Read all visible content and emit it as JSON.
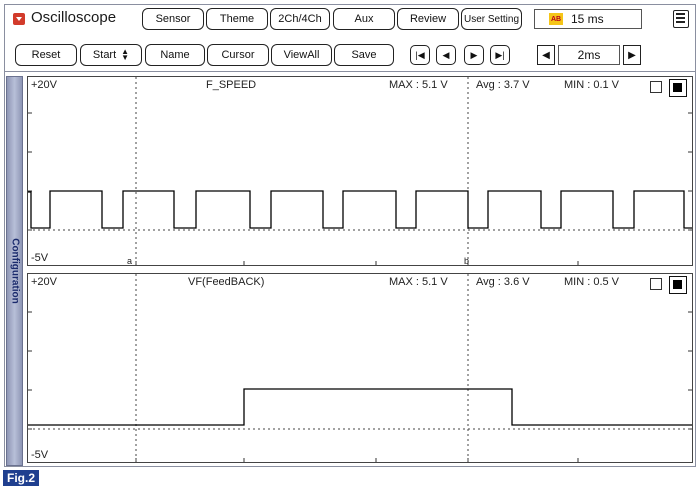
{
  "header": {
    "title": "Oscilloscope",
    "tabs": [
      "Sensor",
      "Theme",
      "2Ch/4Ch",
      "Aux",
      "Review",
      "User Setting"
    ],
    "time_badge": "AB",
    "time_value": "15 ms"
  },
  "toolbar": {
    "reset": "Reset",
    "start": "Start",
    "name": "Name",
    "cursor": "Cursor",
    "viewall": "ViewAll",
    "save": "Save",
    "time_div": "2ms"
  },
  "sidetab": {
    "label": "Configuration"
  },
  "channels": [
    {
      "name": "F_SPEED",
      "top_range": "+20V",
      "bottom_range": "-5V",
      "max": "MAX : 5.1 V",
      "avg": "Avg : 3.7 V",
      "min": "MIN : 0.1 V",
      "cursor_a": "a",
      "cursor_b": "b"
    },
    {
      "name": "VF(FeedBACK)",
      "top_range": "+20V",
      "bottom_range": "-5V",
      "max": "MAX : 5.1 V",
      "avg": "Avg : 3.6 V",
      "min": "MIN : 0.5 V"
    }
  ],
  "figure_label": "Fig.2",
  "colors": {
    "fig_label_bg": "#1f3f8f",
    "sidetab": "#a7aecb",
    "trace": "#000000"
  }
}
